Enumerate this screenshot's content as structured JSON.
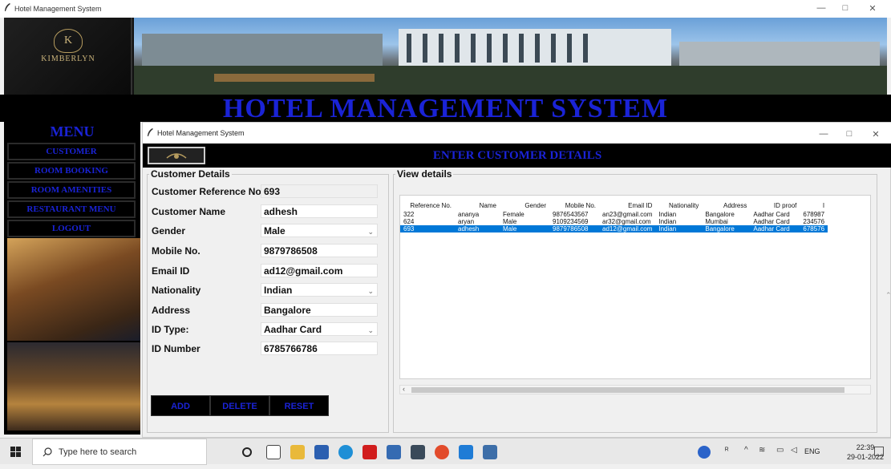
{
  "outer_window": {
    "title": "Hotel Management System",
    "controls": [
      "—",
      "□",
      "✕"
    ]
  },
  "banner": {
    "logo_text": "KIMBERLYN",
    "logo_mark": "K"
  },
  "main_title": "HOTEL MANAGEMENT SYSTEM",
  "menu": {
    "title": "MENU",
    "items": [
      "CUSTOMER",
      "ROOM BOOKING",
      "ROOM AMENITIES",
      "RESTAURANT MENU",
      "LOGOUT"
    ]
  },
  "inner_window": {
    "title": "Hotel Management System",
    "controls": [
      "—",
      "□",
      "✕"
    ]
  },
  "heading": "ENTER CUSTOMER DETAILS",
  "customer_details": {
    "legend": "Customer Details",
    "fields": [
      {
        "label": "Customer Reference No.",
        "value": "693"
      },
      {
        "label": "Customer Name",
        "value": "adhesh"
      },
      {
        "label": "Gender",
        "value": "Male"
      },
      {
        "label": "Mobile No.",
        "value": "9879786508"
      },
      {
        "label": "Email ID",
        "value": "ad12@gmail.com"
      },
      {
        "label": "Nationality",
        "value": "Indian"
      },
      {
        "label": "Address",
        "value": "Bangalore"
      },
      {
        "label": "ID Type:",
        "value": "Aadhar Card"
      },
      {
        "label": "ID Number",
        "value": "6785766786"
      }
    ],
    "buttons": {
      "add": "ADD",
      "delete": "DELETE",
      "reset": "RESET"
    }
  },
  "view_details": {
    "legend": "View details",
    "columns": [
      "Reference No.",
      "Name",
      "Gender",
      "Mobile No.",
      "Email ID",
      "Nationality",
      "Address",
      "ID proof",
      "I"
    ],
    "rows": [
      [
        "322",
        "ananya",
        "Female",
        "9876543567",
        "an23@gmail.com",
        "Indian",
        "Bangalore",
        "Aadhar Card",
        "678987"
      ],
      [
        "624",
        "aryan",
        "Male",
        "9109234569",
        "ar32@gmail.com",
        "Indian",
        "Mumbai",
        "Aadhar Card",
        "234576"
      ],
      [
        "693",
        "adhesh",
        "Male",
        "9879786508",
        "ad12@gmail.com",
        "Indian",
        "Bangalore",
        "Aadhar Card",
        "678576"
      ]
    ],
    "selected_row": 2
  },
  "taskbar": {
    "search_placeholder": "Type here to search",
    "lang": "ENG",
    "time": "22:39",
    "date": "29-01-2022"
  },
  "colors": {
    "accent_blue": "#1a23d6",
    "selection": "#0078d7"
  }
}
